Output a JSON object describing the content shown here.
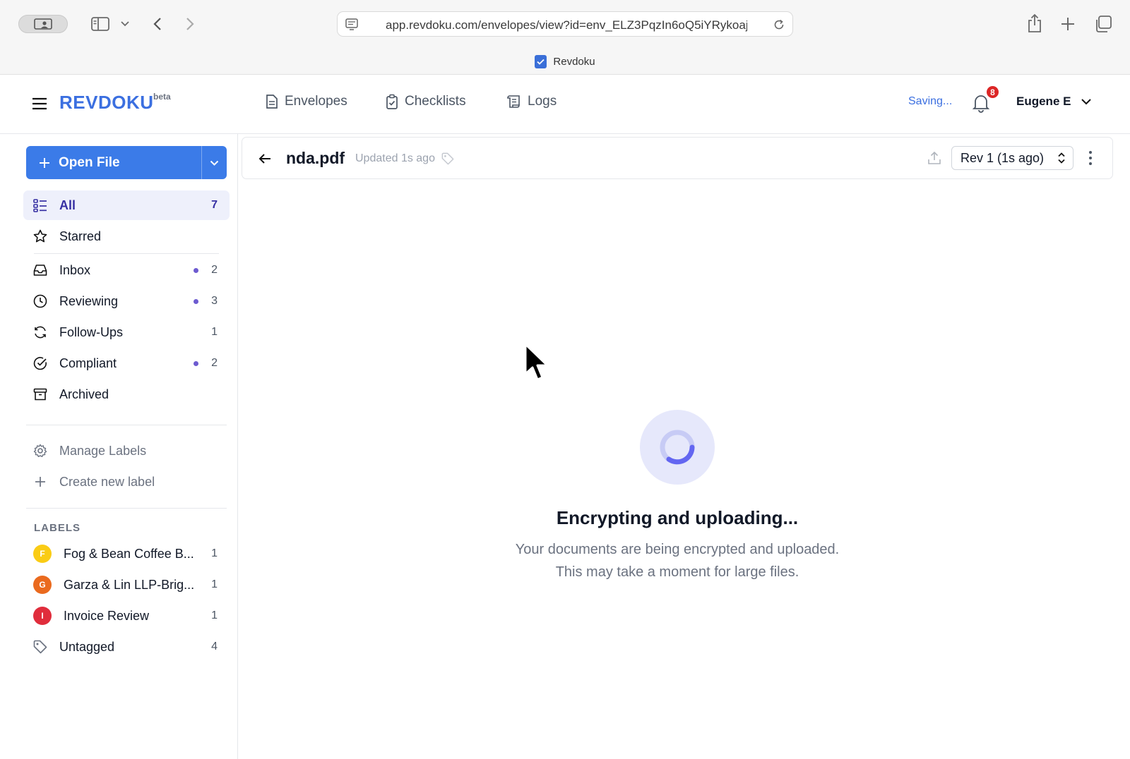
{
  "browser": {
    "url": "app.revdoku.com/envelopes/view?id=env_ELZ3PqzIn6oQ5iYRykoaj",
    "tab_title": "Revdoku"
  },
  "header": {
    "brand": "REVDOKU",
    "brand_badge": "beta",
    "nav": [
      {
        "label": "Envelopes",
        "icon": "document-icon"
      },
      {
        "label": "Checklists",
        "icon": "clipboard-check-icon"
      },
      {
        "label": "Logs",
        "icon": "scroll-icon"
      }
    ],
    "saving_status": "Saving...",
    "notification_count": "8",
    "user_name": "Eugene E"
  },
  "sidebar": {
    "open_file_label": "Open File",
    "items": [
      {
        "label": "All",
        "count": "7",
        "active": true
      },
      {
        "label": "Starred",
        "count": ""
      },
      {
        "label": "Inbox",
        "count": "2",
        "dot": true
      },
      {
        "label": "Reviewing",
        "count": "3",
        "dot": true
      },
      {
        "label": "Follow-Ups",
        "count": "1"
      },
      {
        "label": "Compliant",
        "count": "2",
        "dot": true
      },
      {
        "label": "Archived",
        "count": ""
      }
    ],
    "manage_labels": "Manage Labels",
    "create_label": "Create new label",
    "labels_heading": "LABELS",
    "labels": [
      {
        "initial": "F",
        "label": "Fog & Bean Coffee B...",
        "count": "1",
        "color": "#facc15"
      },
      {
        "initial": "G",
        "label": "Garza & Lin LLP-Brig...",
        "count": "1",
        "color": "#ea6a1e"
      },
      {
        "initial": "I",
        "label": "Invoice Review",
        "count": "1",
        "color": "#e02d3c"
      }
    ],
    "untagged_label": "Untagged",
    "untagged_count": "4"
  },
  "document": {
    "title": "nda.pdf",
    "updated": "Updated 1s ago",
    "revision": "Rev 1 (1s ago)"
  },
  "loading": {
    "title": "Encrypting and uploading...",
    "line1": "Your documents are being encrypted and uploaded.",
    "line2": "This may take a moment for large files."
  },
  "colors": {
    "brand": "#3b6fe0",
    "primary_button": "#3b7be8",
    "active_bg": "#eef0fb",
    "badge": "#dc2626",
    "status_dot": "#6d5bd0"
  }
}
